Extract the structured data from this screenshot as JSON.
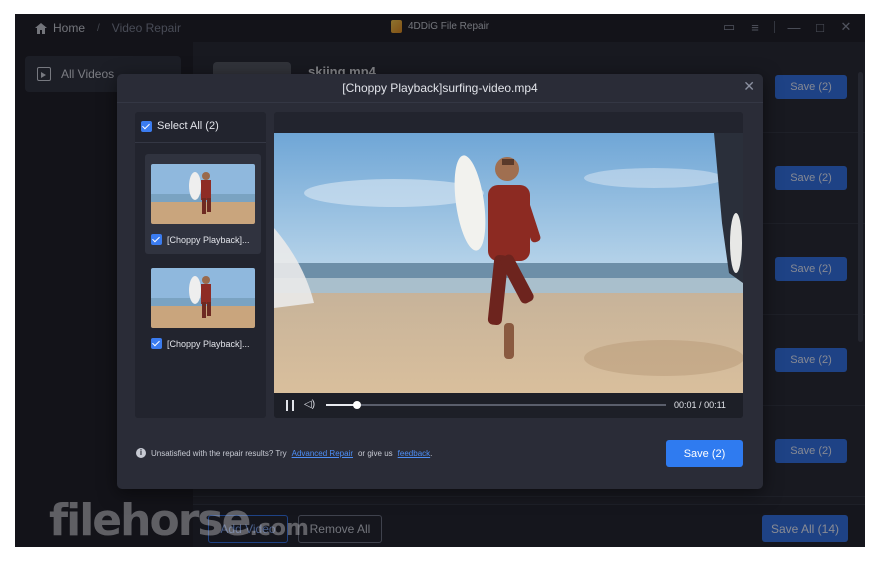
{
  "titlebar": {
    "breadcrumb_home": "Home",
    "breadcrumb_sep": "/",
    "breadcrumb_current": "Video Repair",
    "app_title": "4DDiG File Repair"
  },
  "sidebar": {
    "items": [
      {
        "label": "All Videos",
        "icon": "video-folder-icon"
      }
    ]
  },
  "main": {
    "rows": [
      {
        "name": "skiing.mp4",
        "save_label": "Save (2)"
      },
      {
        "name": "",
        "save_label": "Save (2)"
      },
      {
        "name": "",
        "save_label": "Save (2)"
      },
      {
        "name": "",
        "save_label": "Save (2)"
      },
      {
        "name": "",
        "save_label": "Save (2)"
      }
    ],
    "add_video_label": "Add Video",
    "remove_all_label": "Remove All",
    "save_all_label": "Save All (14)"
  },
  "modal": {
    "title": "[Choppy Playback]surfing-video.mp4",
    "close": "✕",
    "select_all_label": "Select All (2)",
    "clips": [
      {
        "label": "[Choppy Playback]...",
        "checked": true
      },
      {
        "label": "[Choppy Playback]...",
        "checked": true
      }
    ],
    "player": {
      "current_time": "00:01",
      "time_sep": "/",
      "duration": "00:11",
      "progress": 0.09
    },
    "note_prefix": "Unsatisfied with the repair results? Try",
    "note_link1": "Advanced Repair",
    "note_middle": "or give us",
    "note_link2": "feedback",
    "note_end": ".",
    "save_label": "Save (2)"
  },
  "watermark": {
    "text": "filehorse",
    "suffix": ".com"
  },
  "colors": {
    "accent": "#2f6fe6",
    "background": "#1e2029",
    "link": "#4d8ef5"
  }
}
